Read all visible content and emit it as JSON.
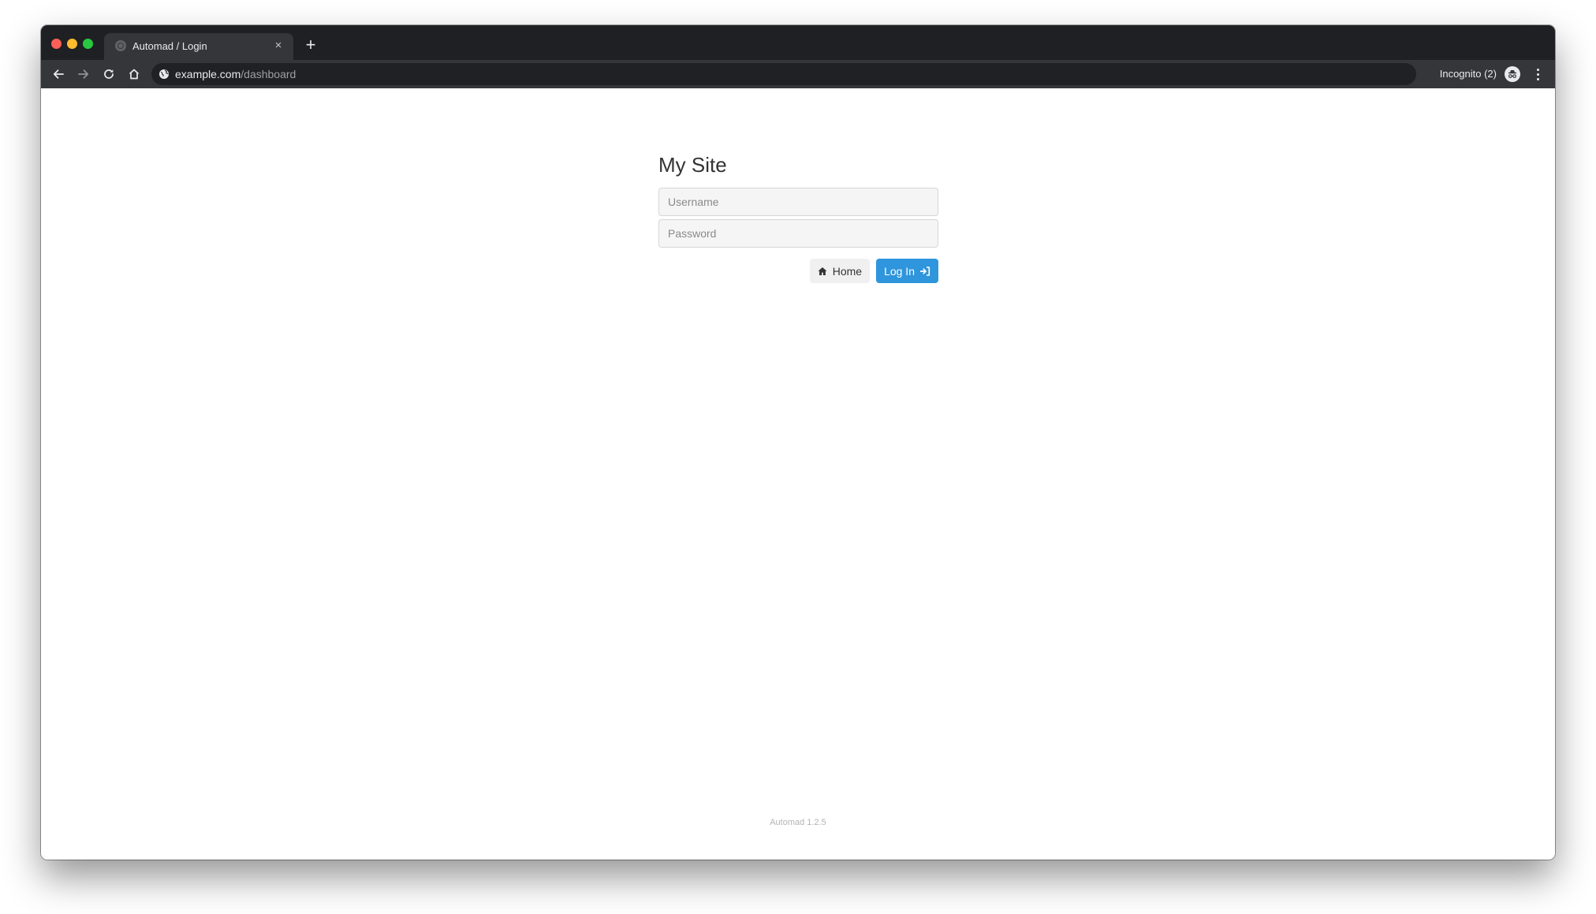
{
  "browser": {
    "tab": {
      "title": "Automad / Login",
      "close_glyph": "×"
    },
    "new_tab_glyph": "+",
    "address": {
      "host": "example.com",
      "path": "/dashboard"
    },
    "profile": {
      "label": "Incognito (2)"
    },
    "icons": {
      "back": "arrow-left-icon",
      "forward": "arrow-right-icon",
      "reload": "reload-icon",
      "home": "home-icon",
      "site_info": "globe-icon",
      "incognito": "incognito-icon",
      "menu": "kebab-menu-icon"
    },
    "colors": {
      "frame": "#1f2023",
      "toolbar": "#35363a",
      "omnibox": "#202124"
    }
  },
  "page": {
    "site_title": "My Site",
    "username": {
      "placeholder": "Username",
      "value": ""
    },
    "password": {
      "placeholder": "Password",
      "value": ""
    },
    "home_button": {
      "label": "Home",
      "icon": "home-icon"
    },
    "login_button": {
      "label": "Log In",
      "icon": "sign-in-icon"
    },
    "footer_version": "Automad 1.2.5",
    "colors": {
      "primary": "#2f95dc",
      "secondary_button": "#f0f0f0",
      "title_text": "#333333"
    }
  }
}
